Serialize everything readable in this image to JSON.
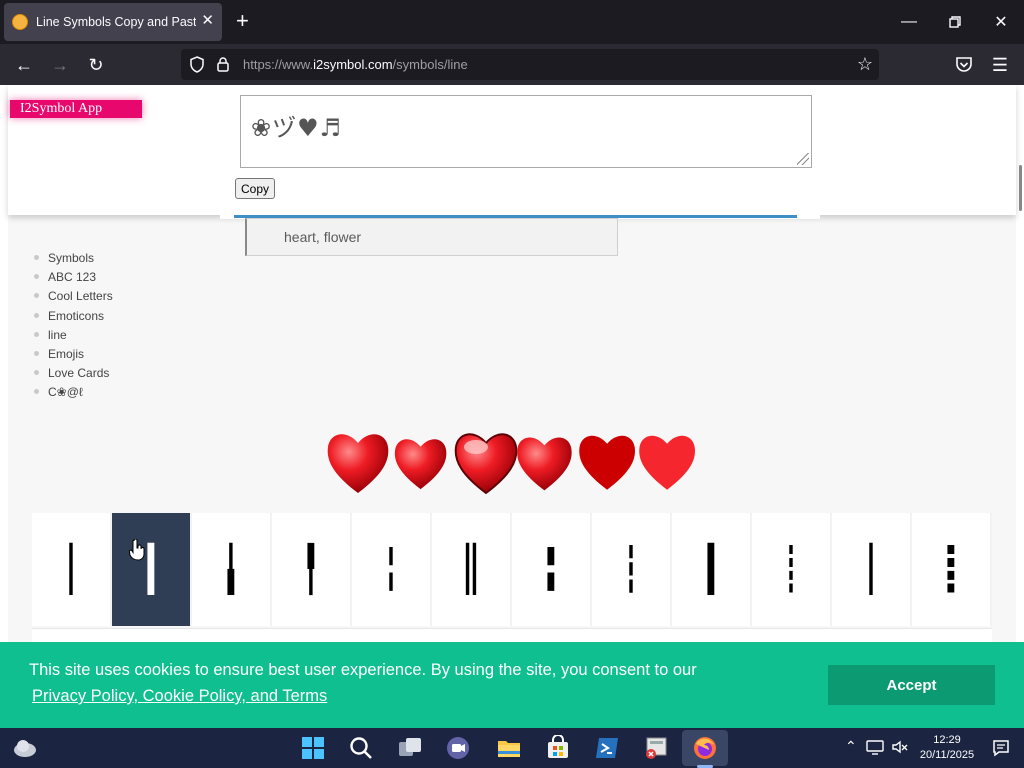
{
  "browser": {
    "tab_title": "Line Symbols Copy and Paste",
    "url_prefix": "https://www.",
    "url_host": "i2symbol.com",
    "url_path": "/symbols/line"
  },
  "header": {
    "app_badge": "I2Symbol App",
    "compose_text": "❀ヅ♥♬",
    "copy_label": "Copy",
    "search_value": "heart, flower"
  },
  "sidenav": {
    "items": [
      "Symbols",
      "ABC 123",
      "Cool Letters",
      "Emoticons",
      "line",
      "Emojis",
      "Love Cards",
      "C❀@ℓ"
    ]
  },
  "symbols": [
    "│",
    "┃",
    "╽",
    "╿",
    "╎",
    "║",
    "╏",
    "┆",
    "┃",
    "┊",
    "│",
    "┋"
  ],
  "cookie": {
    "message": "This site uses cookies to ensure best user experience. By using the site, you consent to our",
    "link": "Privacy Policy, Cookie Policy, and Terms",
    "accept_label": "Accept"
  },
  "taskbar": {
    "time": "12:29",
    "date": "20/11/2025"
  },
  "colors": {
    "badge": "#e8086d",
    "cookie_bar": "#0fbf8f",
    "accept_button": "#0c9a72",
    "active_cell": "#2f3d55",
    "heart": "#e0131b"
  }
}
